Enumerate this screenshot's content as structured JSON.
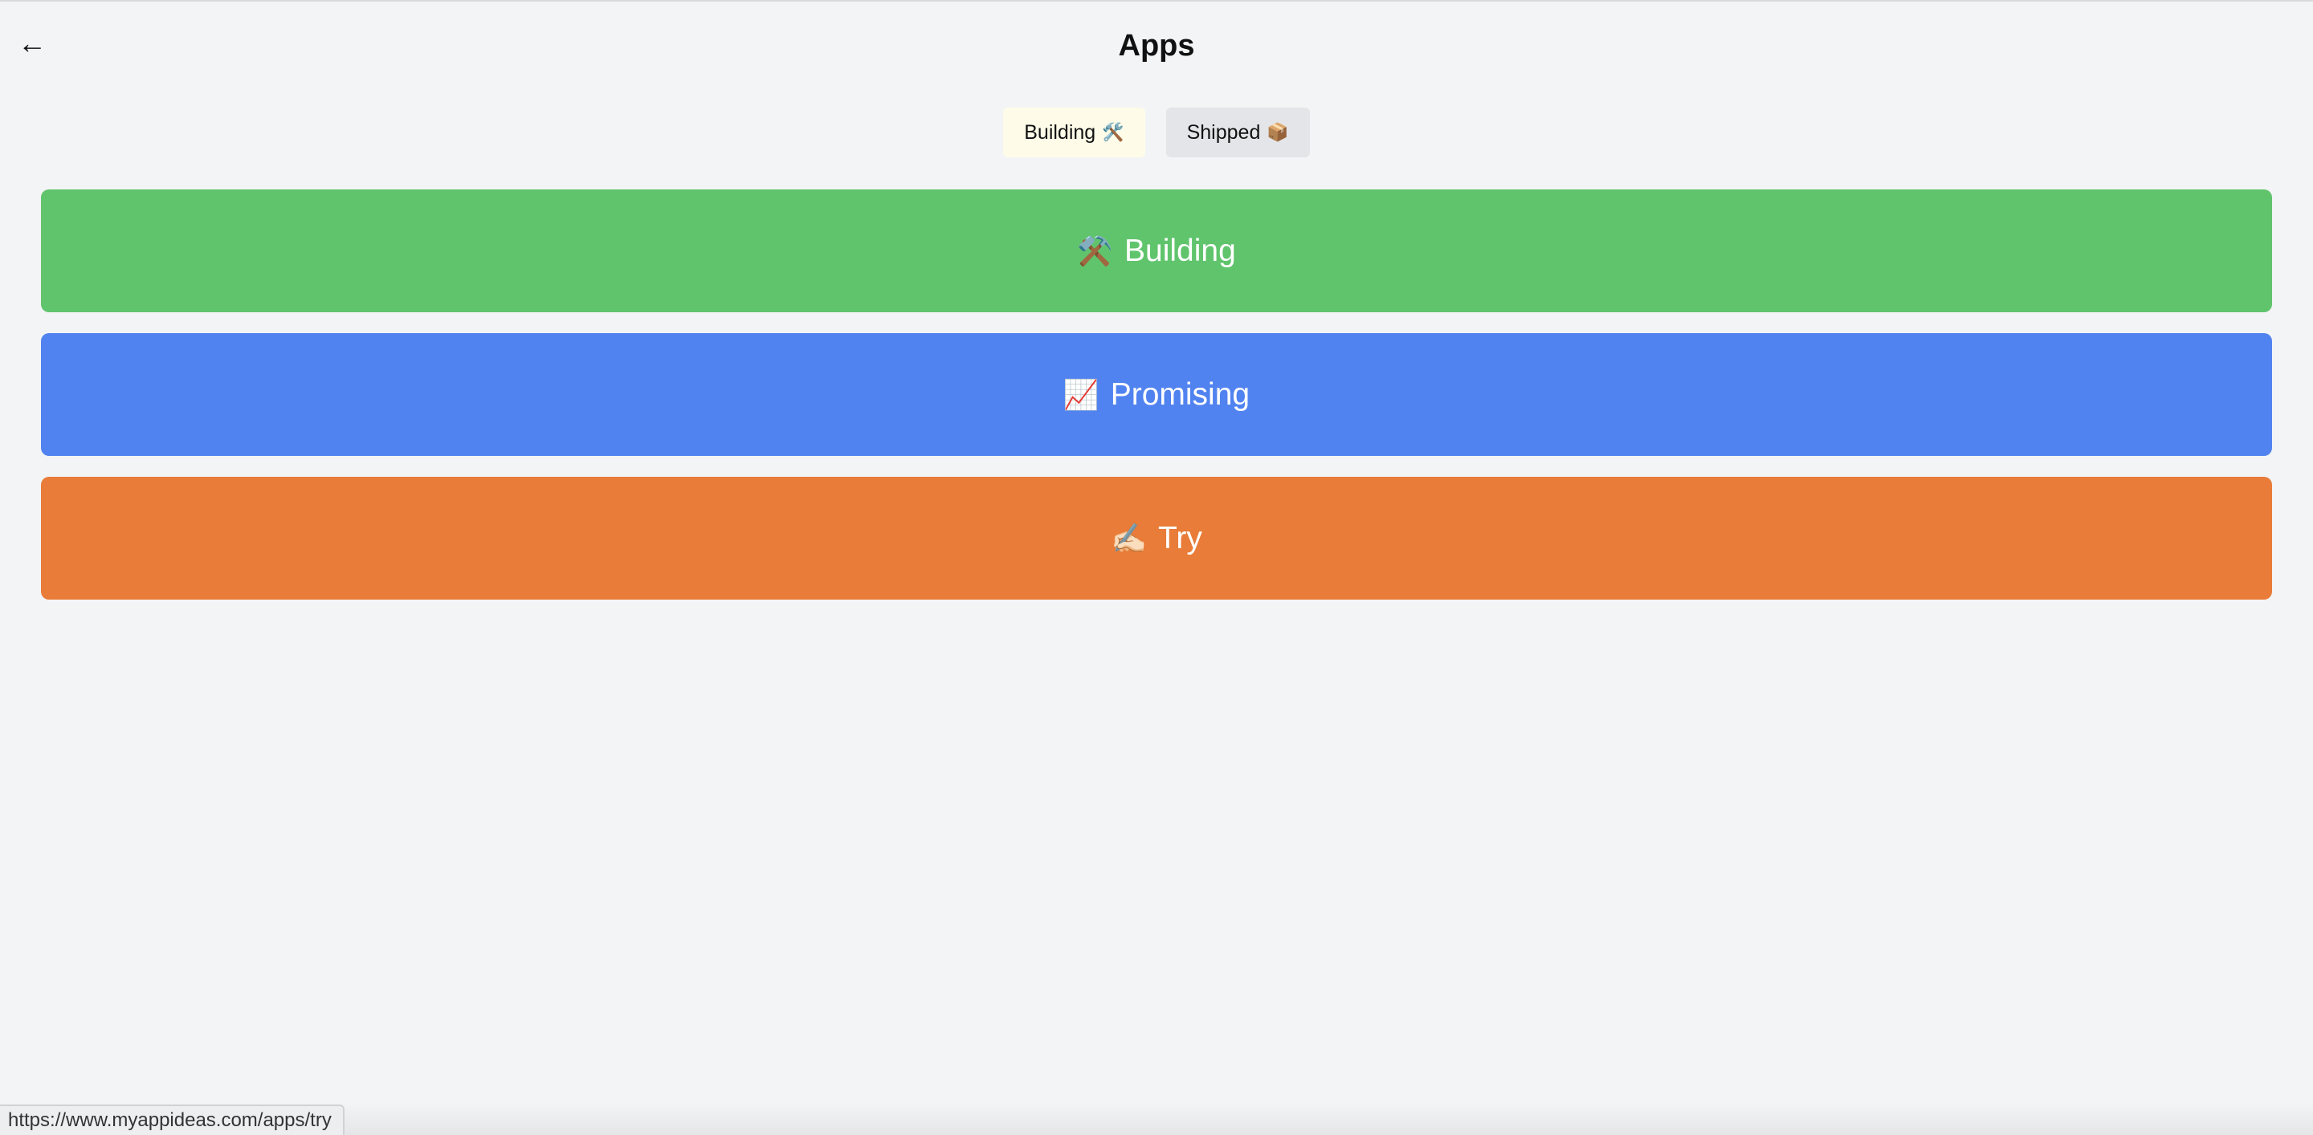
{
  "header": {
    "back_icon": "←",
    "title": "Apps"
  },
  "tabs": [
    {
      "label": "Building",
      "emoji": "🛠️",
      "active": true
    },
    {
      "label": "Shipped",
      "emoji": "📦",
      "active": false
    }
  ],
  "cards": [
    {
      "icon": "⚒️",
      "label": "Building",
      "color": "#60c46c"
    },
    {
      "icon": "📈",
      "label": "Promising",
      "color": "#5183f0"
    },
    {
      "icon": "✍🏻",
      "label": "Try",
      "color": "#e87c38"
    }
  ],
  "status_bar": {
    "url": "https://www.myappideas.com/apps/try"
  }
}
